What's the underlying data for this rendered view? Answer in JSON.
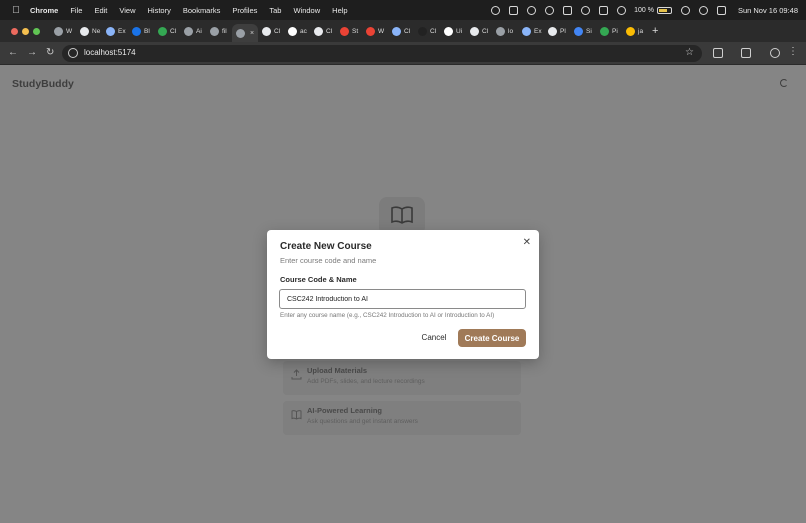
{
  "menubar": {
    "app_name": "Chrome",
    "items": [
      "File",
      "Edit",
      "View",
      "History",
      "Bookmarks",
      "Profiles",
      "Tab",
      "Window",
      "Help"
    ],
    "battery": "100 %",
    "clock": "Sun Nov 16  09:48"
  },
  "tabs": [
    {
      "label": "W",
      "color": "#9aa0a6"
    },
    {
      "label": "Ne",
      "color": "#e8eaed"
    },
    {
      "label": "Ex",
      "color": "#8ab4f8"
    },
    {
      "label": "Bl",
      "color": "#1a73e8"
    },
    {
      "label": "Cl",
      "color": "#34a853"
    },
    {
      "label": "Ai",
      "color": "#9aa0a6"
    },
    {
      "label": "fil",
      "color": "#9aa0a6"
    },
    {
      "label": "",
      "color": "#9aa0a6",
      "active": true
    },
    {
      "label": "Cl",
      "color": "#e8eaed"
    },
    {
      "label": "ac",
      "color": "#ffffff"
    },
    {
      "label": "Cl",
      "color": "#e8eaed"
    },
    {
      "label": "St",
      "color": "#ea4335"
    },
    {
      "label": "W",
      "color": "#ea4335"
    },
    {
      "label": "Cl",
      "color": "#8ab4f8"
    },
    {
      "label": "Cl",
      "color": "#222222"
    },
    {
      "label": "Ui",
      "color": "#ffffff"
    },
    {
      "label": "Cl",
      "color": "#e8eaed"
    },
    {
      "label": "lo",
      "color": "#9aa0a6"
    },
    {
      "label": "Ex",
      "color": "#8ab4f8"
    },
    {
      "label": "Pl",
      "color": "#e8eaed"
    },
    {
      "label": "Si",
      "color": "#4285f4"
    },
    {
      "label": "Pi",
      "color": "#34a853"
    },
    {
      "label": "ja",
      "color": "#fbbc04"
    }
  ],
  "toolbar": {
    "url": "localhost:5174"
  },
  "app": {
    "brand": "StudyBuddy",
    "features": [
      {
        "title": "Upload Materials",
        "description": "Add PDFs, slides, and lecture recordings"
      },
      {
        "title": "AI-Powered Learning",
        "description": "Ask questions and get instant answers"
      }
    ]
  },
  "modal": {
    "title": "Create New Course",
    "subtitle": "Enter course code and name",
    "field_label": "Course Code & Name",
    "input_value": "CSC242 Introduction to AI",
    "hint": "Enter any course name (e.g., CSC242 Introduction to AI or Introduction to AI)",
    "cancel_label": "Cancel",
    "create_label": "Create Course",
    "accent_color": "#a07a58"
  }
}
